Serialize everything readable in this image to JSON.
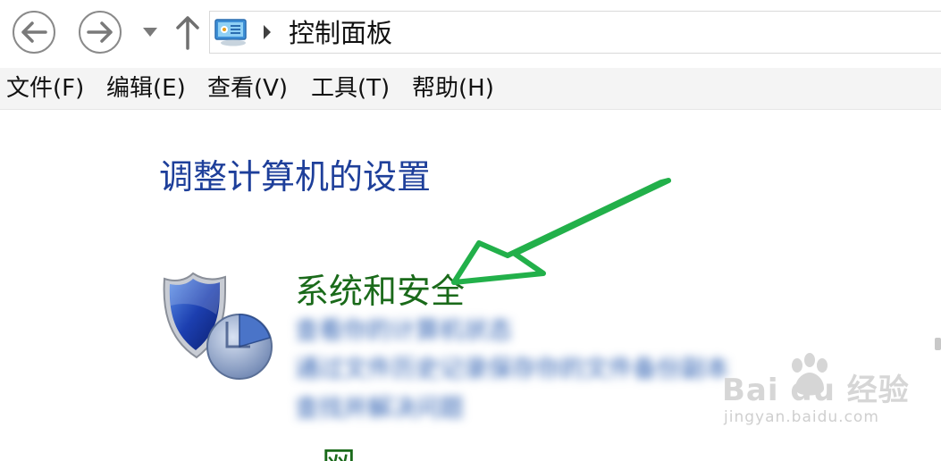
{
  "address": {
    "breadcrumb": "控制面板",
    "icon": "control-panel-icon"
  },
  "menu": [
    {
      "label": "文件(F)"
    },
    {
      "label": "编辑(E)"
    },
    {
      "label": "查看(V)"
    },
    {
      "label": "工具(T)"
    },
    {
      "label": "帮助(H)"
    }
  ],
  "main": {
    "title": "调整计算机的设置",
    "categories": [
      {
        "title": "系统和安全",
        "icon": "shield-security-icon",
        "tasks": [
          {
            "label": "查看你的计算机状态"
          },
          {
            "label": "通过文件历史记录保存你的文件备份副本"
          },
          {
            "label": "查找并解决问题"
          }
        ]
      }
    ]
  },
  "annotation": {
    "arrow_color": "#22b04a"
  },
  "watermark": {
    "brand": "Bai  du 经验",
    "sub": "jingyan.baidu.com"
  },
  "colors": {
    "title_blue": "#1e3f9a",
    "category_green": "#1a6a1a",
    "link_blue": "#2a5db0",
    "menubar_bg": "#f4f4f4"
  }
}
